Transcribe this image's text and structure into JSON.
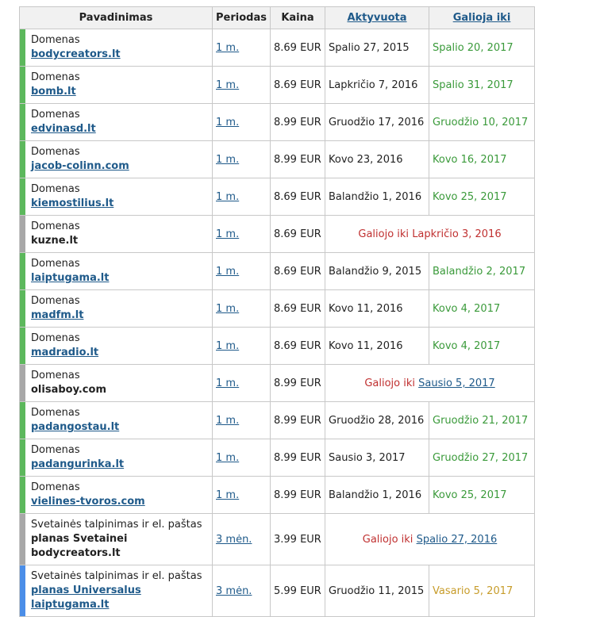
{
  "headers": {
    "name": "Pavadinimas",
    "period": "Periodas",
    "price": "Kaina",
    "activated": "Aktyvuota",
    "valid_until": "Galioja iki"
  },
  "colors": {
    "active": "#5cb85c",
    "expired": "#a8a8a8",
    "hosting_active": "#4b8ee8",
    "valid_text": "#3a9a3a",
    "warning_text": "#c79c2a",
    "expired_text": "#c03030",
    "link": "#1f5a8a"
  },
  "expired_prefix": "Galiojo iki",
  "rows": [
    {
      "type": "Domenas",
      "name": "bodycreators.lt",
      "period": "1 m.",
      "price": "8.69 EUR",
      "activated": "Spalio 27, 2015",
      "valid_until": "Spalio 20, 2017"
    },
    {
      "type": "Domenas",
      "name": "bomb.lt",
      "period": "1 m.",
      "price": "8.69 EUR",
      "activated": "Lapkričio 7, 2016",
      "valid_until": "Spalio 31, 2017"
    },
    {
      "type": "Domenas",
      "name": "edvinasd.lt",
      "period": "1 m.",
      "price": "8.99 EUR",
      "activated": "Gruodžio 17, 2016",
      "valid_until": "Gruodžio 10, 2017"
    },
    {
      "type": "Domenas",
      "name": "jacob-colinn.com",
      "period": "1 m.",
      "price": "8.99 EUR",
      "activated": "Kovo 23, 2016",
      "valid_until": "Kovo 16, 2017"
    },
    {
      "type": "Domenas",
      "name": "kiemostilius.lt",
      "period": "1 m.",
      "price": "8.69 EUR",
      "activated": "Balandžio 1, 2016",
      "valid_until": "Kovo 25, 2017"
    },
    {
      "type": "Domenas",
      "name": "kuzne.lt",
      "period": "1 m.",
      "price": "8.69 EUR",
      "expired_date": "Lapkričio 3, 2016"
    },
    {
      "type": "Domenas",
      "name": "laiptugama.lt",
      "period": "1 m.",
      "price": "8.69 EUR",
      "activated": "Balandžio 9, 2015",
      "valid_until": "Balandžio 2, 2017"
    },
    {
      "type": "Domenas",
      "name": "madfm.lt",
      "period": "1 m.",
      "price": "8.69 EUR",
      "activated": "Kovo 11, 2016",
      "valid_until": "Kovo 4, 2017"
    },
    {
      "type": "Domenas",
      "name": "madradio.lt",
      "period": "1 m.",
      "price": "8.69 EUR",
      "activated": "Kovo 11, 2016",
      "valid_until": "Kovo 4, 2017"
    },
    {
      "type": "Domenas",
      "name": "olisaboy.com",
      "period": "1 m.",
      "price": "8.99 EUR",
      "expired_date": "Sausio 5, 2017"
    },
    {
      "type": "Domenas",
      "name": "padangostau.lt",
      "period": "1 m.",
      "price": "8.99 EUR",
      "activated": "Gruodžio 28, 2016",
      "valid_until": "Gruodžio 21, 2017"
    },
    {
      "type": "Domenas",
      "name": "padangurinka.lt",
      "period": "1 m.",
      "price": "8.99 EUR",
      "activated": "Sausio 3, 2017",
      "valid_until": "Gruodžio 27, 2017"
    },
    {
      "type": "Domenas",
      "name": "vielines-tvoros.com",
      "period": "1 m.",
      "price": "8.99 EUR",
      "activated": "Balandžio 1, 2016",
      "valid_until": "Kovo 25, 2017"
    },
    {
      "type": "Svetainės talpinimas ir el. paštas",
      "name_line1": "planas Svetainei",
      "name_line2": "bodycreators.lt",
      "period": "3 mėn.",
      "price": "3.99 EUR",
      "expired_date": "Spalio 27, 2016"
    },
    {
      "type": "Svetainės talpinimas ir el. paštas",
      "name_line1": "planas Universalus",
      "name_line2": "laiptugama.lt",
      "period": "3 mėn.",
      "price": "5.99 EUR",
      "activated": "Gruodžio 11, 2015",
      "valid_until": "Vasario 5, 2017"
    }
  ]
}
